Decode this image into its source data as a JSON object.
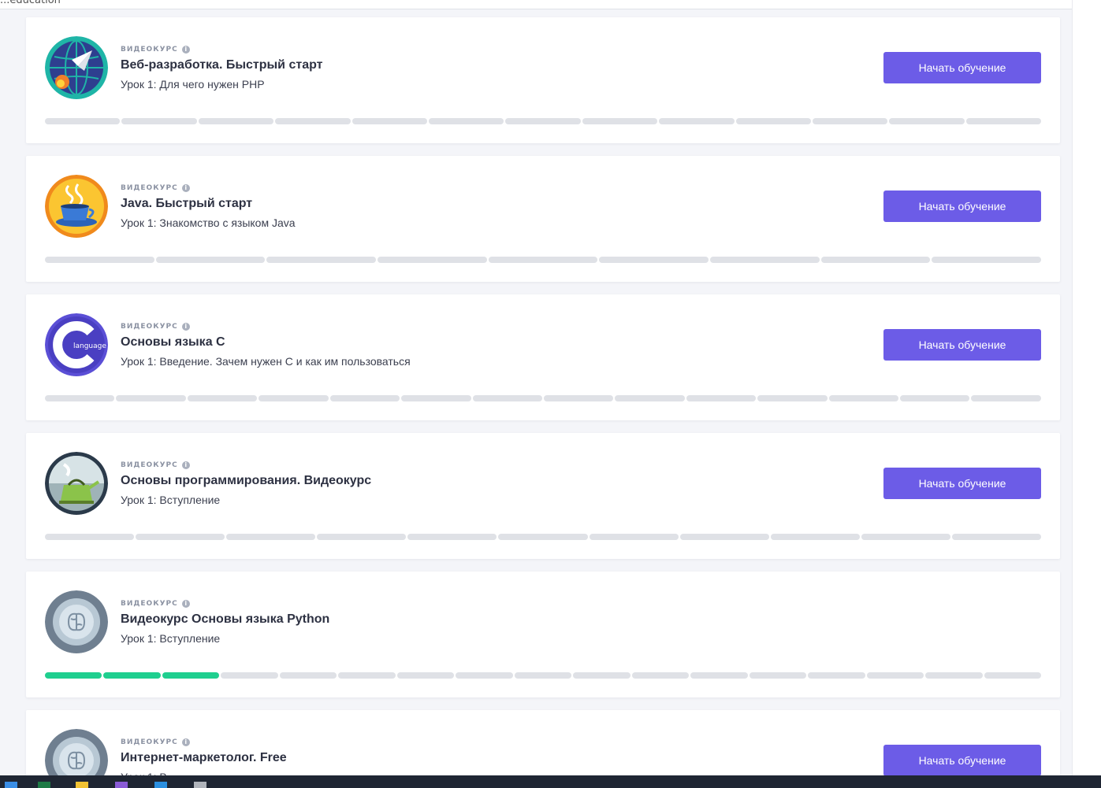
{
  "header": {
    "text": "...education"
  },
  "courses": [
    {
      "badge": "видеокурс",
      "title": "Веб-разработка. Быстрый старт",
      "lesson": "Урок 1: Для чего нужен PHP",
      "button": "Начать обучение",
      "logo": "rocket-globe-icon",
      "segments": 13,
      "completed": 0
    },
    {
      "badge": "видеокурс",
      "title": "Java. Быстрый старт",
      "lesson": "Урок 1: Знакомство с языком Java",
      "button": "Начать обучение",
      "logo": "coffee-cup-icon",
      "segments": 9,
      "completed": 0
    },
    {
      "badge": "видеокурс",
      "title": "Основы языка C",
      "lesson": "Урок 1: Введение. Зачем нужен C и как им пользоваться",
      "button": "Начать обучение",
      "logo": "c-language-icon",
      "logo_text": "language",
      "segments": 14,
      "completed": 0
    },
    {
      "badge": "видеокурс",
      "title": "Основы программирования. Видеокурс",
      "lesson": "Урок 1: Вступление",
      "button": "Начать обучение",
      "logo": "kettle-icon",
      "segments": 11,
      "completed": 0
    },
    {
      "badge": "видеокурс",
      "title": "Видеокурс Основы языка Python",
      "lesson": "Урок 1: Вступление",
      "button": "",
      "logo": "brain-icon",
      "segments": 17,
      "completed": 3
    },
    {
      "badge": "видеокурс",
      "title": "Интернет-маркетолог. Free",
      "lesson": "Урок 1: В...",
      "button": "Начать обучение",
      "logo": "brain-icon",
      "segments": 0,
      "completed": 0
    }
  ],
  "colors": {
    "accent": "#6c5ce7",
    "progress_done": "#1fcf8f",
    "progress_todo": "#dfe1e6"
  },
  "taskbar": {
    "icons": [
      "windows-start-icon",
      "excel-icon",
      "file-explorer-icon",
      "visual-studio-icon",
      "vscode-icon",
      "app-icon"
    ]
  }
}
